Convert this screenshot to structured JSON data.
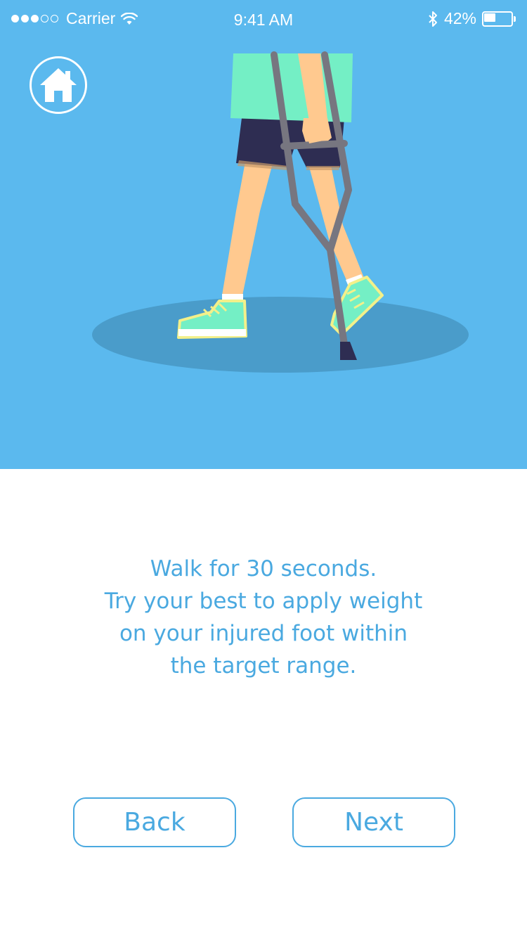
{
  "status_bar": {
    "signal_full": 3,
    "signal_empty": 2,
    "carrier": "Carrier",
    "time": "9:41 AM",
    "battery_text": "42%",
    "battery_level": 0.42
  },
  "home": {
    "icon": "home-icon"
  },
  "instructions": {
    "lines": [
      "Walk for 30 seconds.",
      "Try your best to apply weight",
      "on your injured foot within",
      "the target range."
    ]
  },
  "buttons": {
    "back": "Back",
    "next": "Next"
  },
  "colors": {
    "hero_bg": "#5bb9ee",
    "accent": "#4aa9e0",
    "shadow": "#4a9cca",
    "shirt": "#74efc5",
    "shorts": "#2e2d52",
    "skin": "#ffc98f",
    "crutch": "#777680",
    "shoe": "#74efc5",
    "shoe_outline": "#f3f08a"
  }
}
